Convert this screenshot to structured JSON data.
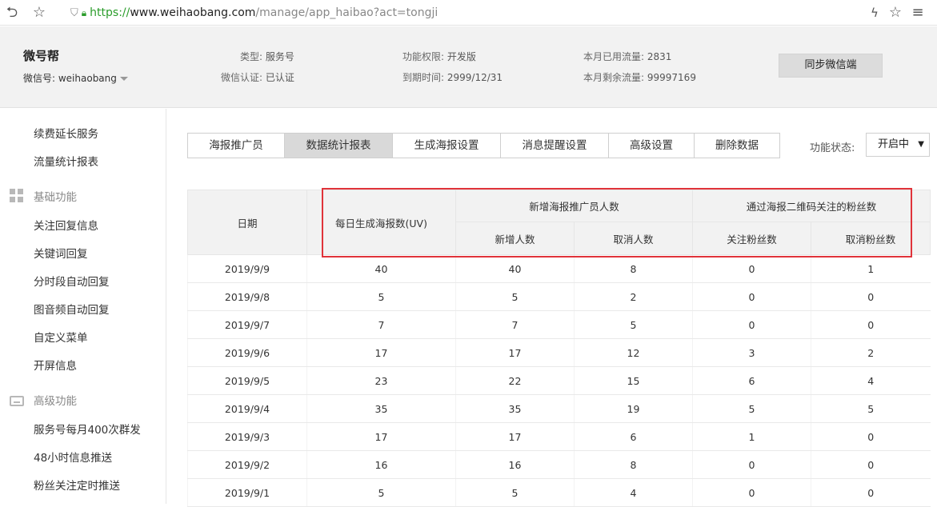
{
  "browser": {
    "url_protocol": "https://",
    "url_host": "www.weihaobang.com",
    "url_path": "/manage/app_haibao?act=tongji"
  },
  "header": {
    "account_name": "微号帮",
    "wechat_id_label": "微信号: weihaobang",
    "type_label": "类型:",
    "type_value": "服务号",
    "verify_label": "微信认证:",
    "verify_value": "已认证",
    "perm_label": "功能权限:",
    "perm_value": "开发版",
    "expire_label": "到期时间:",
    "expire_value": "2999/12/31",
    "used_label": "本月已用流量:",
    "used_value": "2831",
    "remain_label": "本月剩余流量:",
    "remain_value": "99997169",
    "sync_button": "同步微信端"
  },
  "sidebar": {
    "items_top": [
      "续费延长服务",
      "流量统计报表"
    ],
    "group_basic": "基础功能",
    "items_basic": [
      "关注回复信息",
      "关键词回复",
      "分时段自动回复",
      "图音频自动回复",
      "自定义菜单",
      "开屏信息"
    ],
    "group_advanced": "高级功能",
    "items_advanced": [
      "服务号每月400次群发",
      "48小时信息推送",
      "粉丝关注定时推送"
    ]
  },
  "tabs": [
    "海报推广员",
    "数据统计报表",
    "生成海报设置",
    "消息提醒设置",
    "高级设置",
    "删除数据"
  ],
  "active_tab": 1,
  "status": {
    "label": "功能状态:",
    "value": "开启中"
  },
  "table": {
    "headers": {
      "date": "日期",
      "daily_posters": "每日生成海报数(UV)",
      "new_promoters_group": "新增海报推广员人数",
      "new_count": "新增人数",
      "cancel_count": "取消人数",
      "fans_group": "通过海报二维码关注的粉丝数",
      "follow_fans": "关注粉丝数",
      "unfollow_fans": "取消粉丝数"
    },
    "rows": [
      [
        "2019/9/9",
        "40",
        "40",
        "8",
        "0",
        "1"
      ],
      [
        "2019/9/8",
        "5",
        "5",
        "2",
        "0",
        "0"
      ],
      [
        "2019/9/7",
        "7",
        "7",
        "5",
        "0",
        "0"
      ],
      [
        "2019/9/6",
        "17",
        "17",
        "12",
        "3",
        "2"
      ],
      [
        "2019/9/5",
        "23",
        "22",
        "15",
        "6",
        "4"
      ],
      [
        "2019/9/4",
        "35",
        "35",
        "19",
        "5",
        "5"
      ],
      [
        "2019/9/3",
        "17",
        "17",
        "6",
        "1",
        "0"
      ],
      [
        "2019/9/2",
        "16",
        "16",
        "8",
        "0",
        "0"
      ],
      [
        "2019/9/1",
        "5",
        "5",
        "4",
        "0",
        "0"
      ]
    ]
  },
  "colors": {
    "highlight_border": "#e0333a",
    "header_bg": "#f2f2f2",
    "active_tab_bg": "#d9d9d9",
    "lock_green": "#2a9c2a"
  }
}
